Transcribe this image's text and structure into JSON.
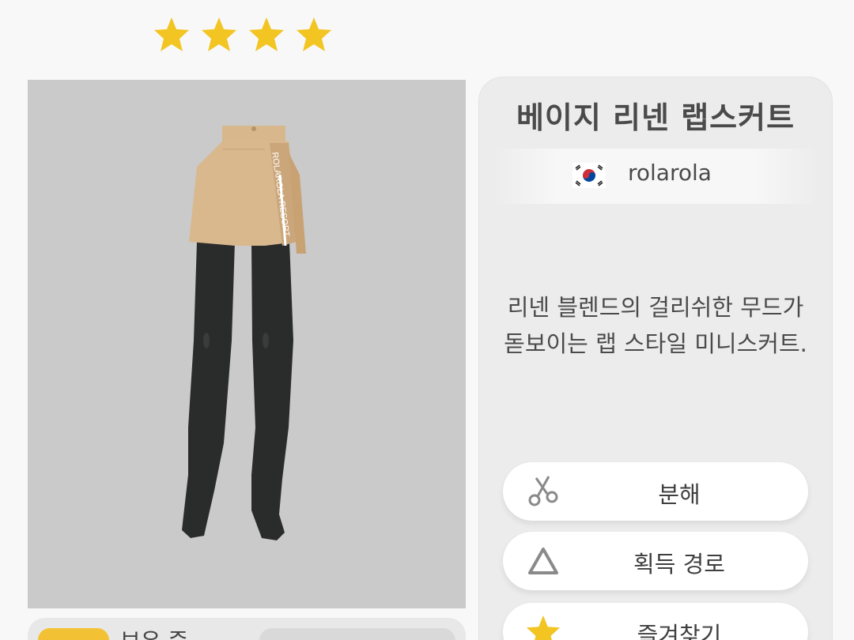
{
  "rating": {
    "stars_filled": 4,
    "star_color": "#f2c523"
  },
  "item": {
    "title": "베이지 리넨 랩스커트",
    "brand": "rolarola",
    "brand_country_flag": "korea-flag-icon",
    "description_line1": "리넨 블렌드의 걸리쉬한 무드가",
    "description_line2": "돋보이는 랩 스타일 미니스커트.",
    "skirt_print": "ROLAROLA RESORT"
  },
  "actions": [
    {
      "label": "분해",
      "icon": "scissors-icon"
    },
    {
      "label": "획득 경로",
      "icon": "triangle-icon"
    },
    {
      "label": "즐겨찾기",
      "icon": "star-icon"
    }
  ],
  "bottom": {
    "owned_label": "보유 중"
  },
  "colors": {
    "preview_bg": "#cacaca",
    "panel_bg": "#ececec",
    "skirt": "#d9b88e",
    "tights": "#2a2c2b",
    "accent": "#f3c234"
  }
}
